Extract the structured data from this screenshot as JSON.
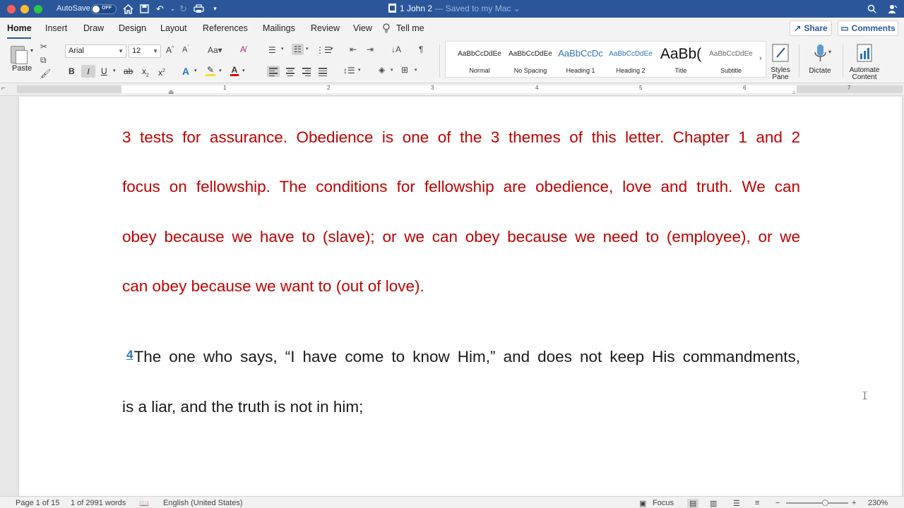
{
  "titlebar": {
    "autosave_label": "AutoSave",
    "autosave_state": "OFF",
    "doc_name": "1 John 2",
    "doc_status": " — Saved to my Mac ⌄"
  },
  "ribbon_tabs": [
    "Home",
    "Insert",
    "Draw",
    "Design",
    "Layout",
    "References",
    "Mailings",
    "Review",
    "View",
    "Tell me"
  ],
  "share_label": "Share",
  "comments_label": "Comments",
  "ribbon": {
    "paste_label": "Paste",
    "font_name": "Arial",
    "font_size": "12",
    "styles": [
      {
        "sample": "AaBbCcDdEe",
        "name": "Normal"
      },
      {
        "sample": "AaBbCcDdEe",
        "name": "No Spacing"
      },
      {
        "sample": "AaBbCcDc",
        "name": "Heading 1"
      },
      {
        "sample": "AaBbCcDdEe",
        "name": "Heading 2"
      },
      {
        "sample": "AaBb(",
        "name": "Title"
      },
      {
        "sample": "AaBbCcDdEe",
        "name": "Subtitle"
      }
    ],
    "styles_pane_label": "Styles Pane",
    "dictate_label": "Dictate",
    "automate_label": "Automate Content"
  },
  "ruler_numbers": [
    "1",
    "2",
    "3",
    "4",
    "5",
    "6",
    "7"
  ],
  "document": {
    "red_lines": [
      "3 tests for assurance. Obedience is one of the 3 themes of this letter. Chapter 1 and 2",
      "focus on fellowship. The conditions for fellowship are obedience, love and truth. We can",
      "obey because we have to (slave); or we can obey because we need to (employee), or we",
      "can obey because we want to (out of love)."
    ],
    "verse_number": "4",
    "verse_lines": [
      "The one who says, “I have come to know Him,” and does not keep His commandments,",
      "is a liar, and the truth is not in him;"
    ]
  },
  "statusbar": {
    "page": "Page 1 of 15",
    "words": "1 of 2991 words",
    "language": "English (United States)",
    "focus": "Focus",
    "zoom": "230%"
  },
  "colors": {
    "brand": "#2b579a",
    "red_text": "#c00000",
    "verse_number": "#2e75b6"
  }
}
